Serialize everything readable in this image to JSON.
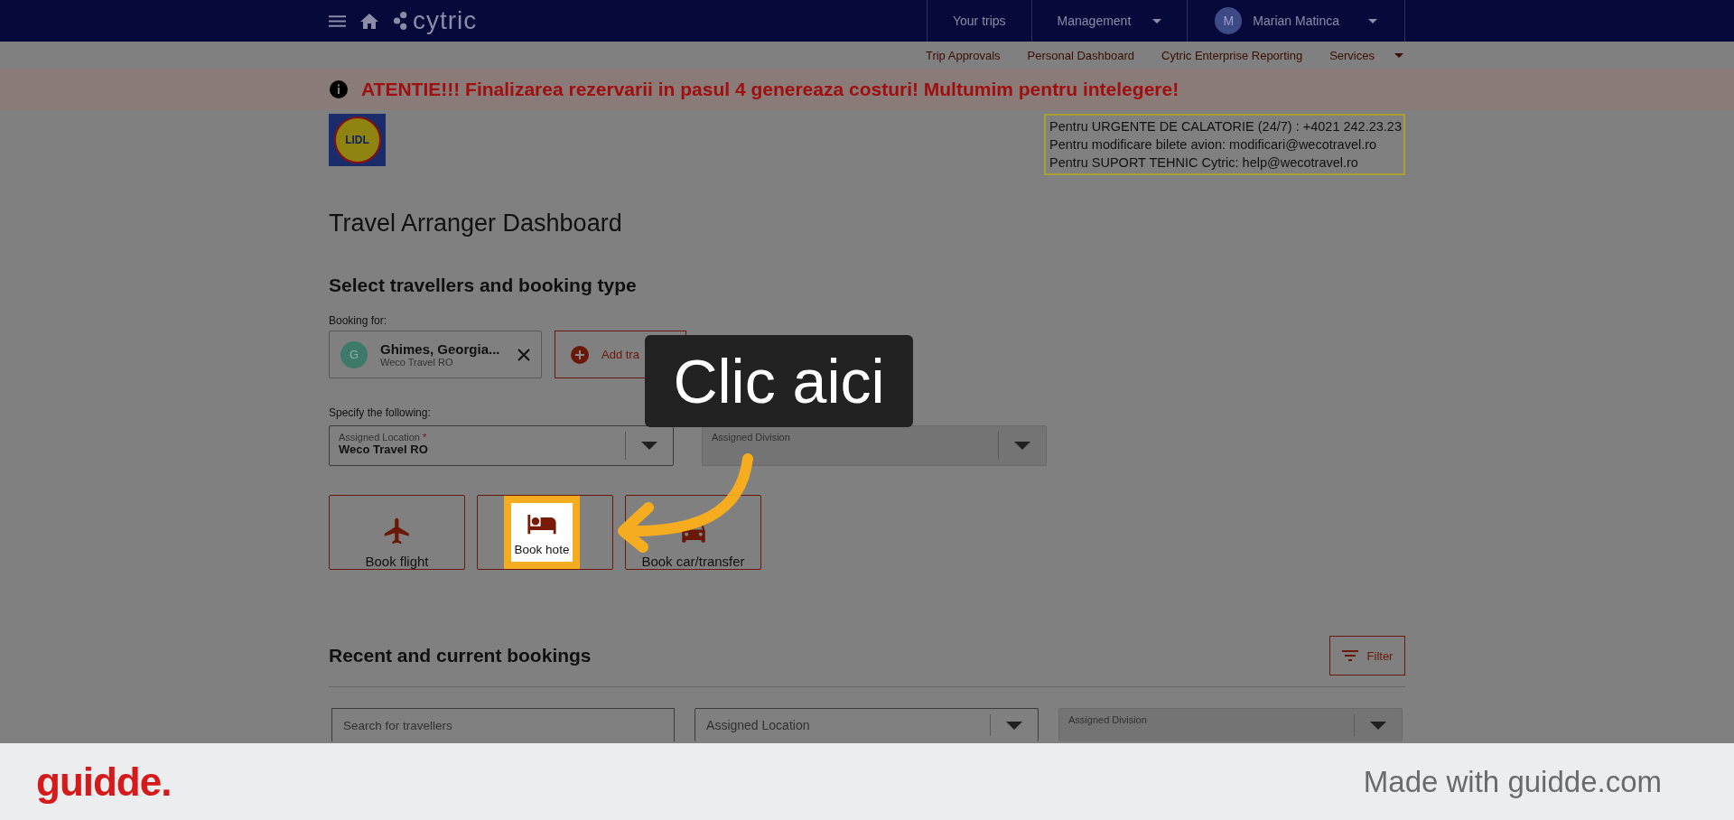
{
  "topbar": {
    "brand": "cytric",
    "links": [
      {
        "label": "Your trips",
        "dropdown": false
      },
      {
        "label": "Management",
        "dropdown": true
      }
    ],
    "user": {
      "initial": "M",
      "name": "Marian Matinca"
    }
  },
  "subnav": [
    {
      "label": "Trip Approvals",
      "dropdown": false
    },
    {
      "label": "Personal Dashboard",
      "dropdown": false
    },
    {
      "label": "Cytric Enterprise Reporting",
      "dropdown": false
    },
    {
      "label": "Services",
      "dropdown": true
    }
  ],
  "banner": {
    "text": "ATENTIE!!! Finalizarea rezervarii in pasul 4 genereaza costuri! Multumim pentru intelegere!"
  },
  "logo": {
    "text": "LIDL"
  },
  "contact_lines": [
    "Pentru URGENTE DE CALATORIE (24/7) : +4021 242.23.23",
    "Pentru modificare bilete avion:  modificari@wecotravel.ro",
    "Pentru SUPORT TEHNIC Cytric:  help@wecotravel.ro"
  ],
  "title": "Travel Arranger Dashboard",
  "booking_section": {
    "heading": "Select travellers and booking type",
    "booking_for_label": "Booking for:",
    "traveller": {
      "initial": "G",
      "name": "Ghimes, Georgia...",
      "company": "Weco Travel RO"
    },
    "add_button": "Add tra",
    "specify_label": "Specify the following:",
    "selects": [
      {
        "label": "Assigned Location",
        "required_mark": "*",
        "value": "Weco Travel RO",
        "disabled": false
      },
      {
        "label": "Assigned Division",
        "disabled": true
      }
    ],
    "book_buttons": [
      {
        "kind": "flight",
        "label": "Book flight",
        "spotlight": false
      },
      {
        "kind": "hotel",
        "label": "Book hote",
        "spotlight": true
      },
      {
        "kind": "car",
        "label": "Book car/transfer",
        "spotlight": false
      }
    ]
  },
  "recent": {
    "heading": "Recent and current bookings",
    "filter_button": "Filter",
    "search": {
      "placeholder": "Search for travellers"
    },
    "location_select": {
      "placeholder": "Assigned Location"
    },
    "division_select": {
      "label": "Assigned Division",
      "disabled": true
    }
  },
  "callout": {
    "text": "Clic aici"
  },
  "footer": {
    "brand": "guidde.",
    "credit": "Made with guidde.com"
  }
}
